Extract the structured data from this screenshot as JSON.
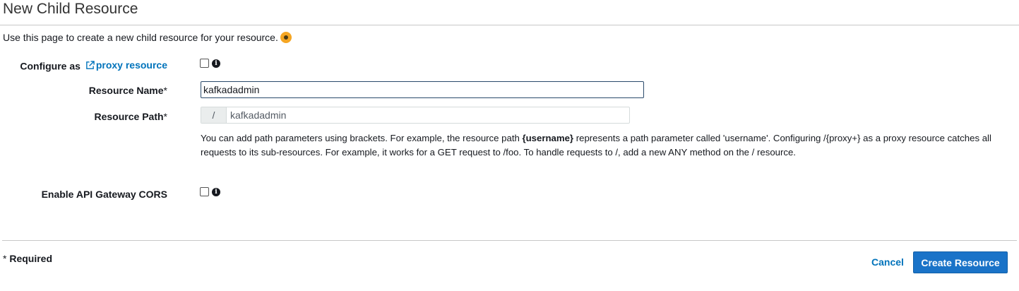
{
  "page": {
    "title": "New Child Resource",
    "description": "Use this page to create a new child resource for your resource."
  },
  "form": {
    "proxy": {
      "label_prefix": "Configure as ",
      "link_text": "proxy resource",
      "checked": false
    },
    "resource_name": {
      "label": "Resource Name",
      "required_mark": "*",
      "value": "kafkadadmin"
    },
    "resource_path": {
      "label": "Resource Path",
      "required_mark": "*",
      "prefix": "/",
      "value": "kafkadadmin"
    },
    "help": {
      "part1": "You can add path parameters using brackets. For example, the resource path ",
      "bold": "{username}",
      "part2": " represents a path parameter called 'username'. Configuring /{proxy+} as a proxy resource catches all requests to its sub-resources. For example, it works for a GET request to /foo. To handle requests to /, add a new ANY method on the / resource."
    },
    "cors": {
      "label": "Enable API Gateway CORS",
      "checked": false
    }
  },
  "footer": {
    "required_mark": "*",
    "required_text": " Required",
    "cancel_label": "Cancel",
    "create_label": "Create Resource"
  },
  "icons": {
    "info": "info-icon",
    "external_link": "external-link-icon",
    "status_dot": "status-dot-icon"
  },
  "colors": {
    "link": "#0073bb",
    "primary_button": "#1a73c8",
    "status_dot": "#f5a623"
  }
}
